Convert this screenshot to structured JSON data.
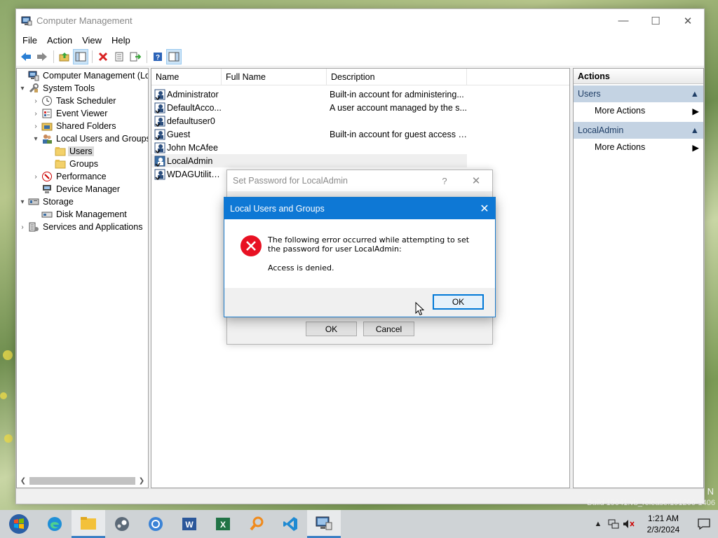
{
  "window": {
    "title": "Computer Management",
    "controls": {
      "minimize": "—",
      "maximize": "☐",
      "close": "✕"
    }
  },
  "menu": [
    "File",
    "Action",
    "View",
    "Help"
  ],
  "tree": [
    {
      "label": "Computer Management (Local",
      "level": 0,
      "expander": "",
      "icon": "computer-management-icon"
    },
    {
      "label": "System Tools",
      "level": 0,
      "expander": "▾",
      "icon": "tools-icon"
    },
    {
      "label": "Task Scheduler",
      "level": 1,
      "expander": "›",
      "icon": "clock-icon"
    },
    {
      "label": "Event Viewer",
      "level": 1,
      "expander": "›",
      "icon": "event-viewer-icon"
    },
    {
      "label": "Shared Folders",
      "level": 1,
      "expander": "›",
      "icon": "shared-folder-icon"
    },
    {
      "label": "Local Users and Groups",
      "level": 1,
      "expander": "▾",
      "icon": "users-icon"
    },
    {
      "label": "Users",
      "level": 2,
      "expander": "",
      "icon": "folder-icon",
      "selected": true
    },
    {
      "label": "Groups",
      "level": 2,
      "expander": "",
      "icon": "folder-icon"
    },
    {
      "label": "Performance",
      "level": 1,
      "expander": "›",
      "icon": "performance-icon"
    },
    {
      "label": "Device Manager",
      "level": 1,
      "expander": "",
      "icon": "device-manager-icon"
    },
    {
      "label": "Storage",
      "level": 0,
      "expander": "▾",
      "icon": "storage-icon"
    },
    {
      "label": "Disk Management",
      "level": 1,
      "expander": "",
      "icon": "disk-icon"
    },
    {
      "label": "Services and Applications",
      "level": 0,
      "expander": "›",
      "icon": "services-icon"
    }
  ],
  "list": {
    "columns": [
      "Name",
      "Full Name",
      "Description"
    ],
    "rows": [
      {
        "name": "Administrator",
        "full_name": "",
        "description": "Built-in account for administering..."
      },
      {
        "name": "DefaultAcco...",
        "full_name": "",
        "description": "A user account managed by the s..."
      },
      {
        "name": "defaultuser0",
        "full_name": "",
        "description": ""
      },
      {
        "name": "Guest",
        "full_name": "",
        "description": "Built-in account for guest access t..."
      },
      {
        "name": "John McAfee",
        "full_name": "",
        "description": ""
      },
      {
        "name": "LocalAdmin",
        "full_name": "",
        "description": "",
        "selected": true
      },
      {
        "name": "WDAGUtility...",
        "full_name": "",
        "description": ""
      }
    ]
  },
  "actions": {
    "title": "Actions",
    "sections": [
      {
        "label": "Users",
        "items": [
          "More Actions"
        ]
      },
      {
        "label": "LocalAdmin",
        "items": [
          "More Actions"
        ]
      }
    ]
  },
  "set_password_dialog": {
    "title": "Set Password for LocalAdmin",
    "help": "?",
    "ok": "OK",
    "cancel": "Cancel"
  },
  "error_dialog": {
    "title": "Local Users and Groups",
    "message": "The following error occurred while attempting to set the password for user LocalAdmin:",
    "detail": "Access is denied.",
    "ok": "OK"
  },
  "taskbar": {
    "apps": [
      "start",
      "edge",
      "file-explorer",
      "steam",
      "chrome",
      "word",
      "excel",
      "search-tool",
      "vscode",
      "computer-management"
    ],
    "active": "computer-management",
    "time": "1:21 AM",
    "date": "2/3/2024"
  },
  "watermark": {
    "corner": "N",
    "build": "Build 19041.vb_release.191206-1406"
  },
  "colors": {
    "title_bar_active": "#0e78d5",
    "actions_section": "#c4d3e3",
    "error_icon": "#e81123"
  }
}
